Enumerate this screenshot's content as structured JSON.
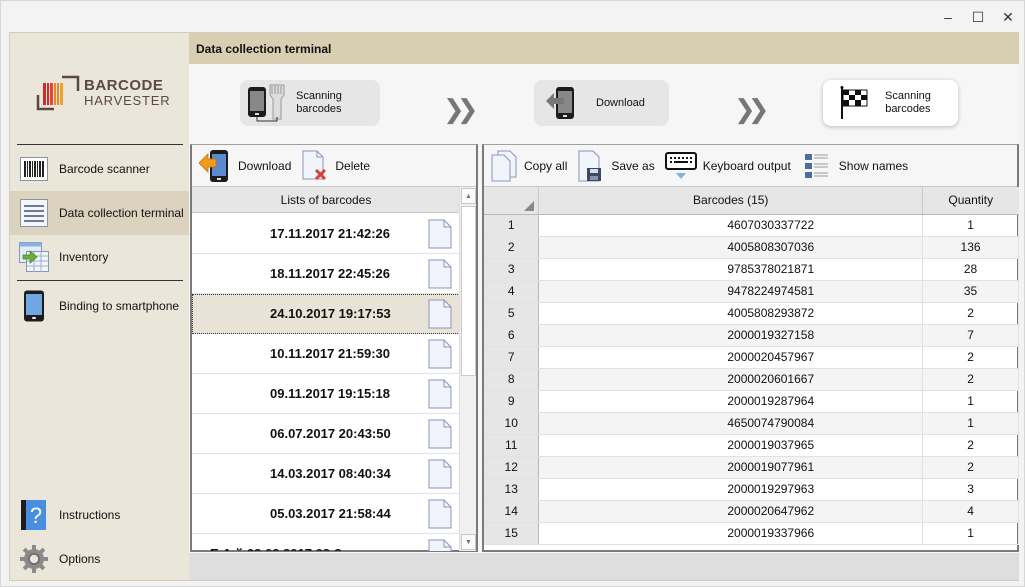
{
  "window": {
    "controls": {
      "minimize": "–",
      "maximize": "☐",
      "close": "✕"
    }
  },
  "logo": {
    "line1": "BARCODE",
    "line2": "HARVESTER"
  },
  "sidebar": {
    "items": [
      {
        "label": "Barcode scanner",
        "icon": "barcode-icon"
      },
      {
        "label": "Data collection terminal",
        "icon": "list-icon",
        "active": true
      },
      {
        "label": "Inventory",
        "icon": "inventory-table-icon"
      },
      {
        "label": "Binding to smartphone",
        "icon": "smartphone-icon"
      }
    ],
    "bottom_items": [
      {
        "label": "Instructions",
        "icon": "help-book-icon"
      },
      {
        "label": "Options",
        "icon": "gear-icon"
      }
    ]
  },
  "header": {
    "title": "Data collection terminal"
  },
  "steps": [
    {
      "label_line1": "Scanning",
      "label_line2": "barcodes",
      "icon": "terminal-scanner-icon"
    },
    {
      "label_line1": "Download",
      "label_line2": "",
      "icon": "download-phone-icon"
    },
    {
      "label_line1": "Scanning",
      "label_line2": "barcodes",
      "icon": "checkered-flag-icon",
      "current": true
    }
  ],
  "left_panel": {
    "toolbar": {
      "download": "Download",
      "delete": "Delete"
    },
    "header": "Lists of barcodes",
    "lists": [
      "17.11.2017 21:42:26",
      "18.11.2017 22:45:26",
      "24.10.2017 19:17:53",
      "10.11.2017 21:59:30",
      "09.11.2017 19:15:18",
      "06.07.2017 20:43:50",
      "14.03.2017 08:40:34",
      "05.03.2017 21:58:44",
      "Е        А       й 03.03.2017 08:3"
    ],
    "selected_index": 2
  },
  "right_panel": {
    "toolbar": {
      "copy_all": "Copy all",
      "save_as": "Save as",
      "keyboard_output": "Keyboard output",
      "show_names": "Show names"
    },
    "columns": {
      "barcodes": "Barcodes (15)",
      "quantity": "Quantity"
    },
    "rows": [
      {
        "n": "1",
        "barcode": "4607030337722",
        "qty": "1"
      },
      {
        "n": "2",
        "barcode": "4005808307036",
        "qty": "136"
      },
      {
        "n": "3",
        "barcode": "9785378021871",
        "qty": "28"
      },
      {
        "n": "4",
        "barcode": "9478224974581",
        "qty": "35"
      },
      {
        "n": "5",
        "barcode": "4005808293872",
        "qty": "2"
      },
      {
        "n": "6",
        "barcode": "2000019327158",
        "qty": "7"
      },
      {
        "n": "7",
        "barcode": "2000020457967",
        "qty": "2"
      },
      {
        "n": "8",
        "barcode": "2000020601667",
        "qty": "2"
      },
      {
        "n": "9",
        "barcode": "2000019287964",
        "qty": "1"
      },
      {
        "n": "10",
        "barcode": "4650074790084",
        "qty": "1"
      },
      {
        "n": "11",
        "barcode": "2000019037965",
        "qty": "2"
      },
      {
        "n": "12",
        "barcode": "2000019077961",
        "qty": "2"
      },
      {
        "n": "13",
        "barcode": "2000019297963",
        "qty": "3"
      },
      {
        "n": "14",
        "barcode": "2000020647962",
        "qty": "4"
      },
      {
        "n": "15",
        "barcode": "2000019337966",
        "qty": "1"
      }
    ]
  },
  "colors": {
    "sidebar_bg": "#ebe6da",
    "title_bar_bg": "#d8cfb3",
    "active_nav_bg": "#dbd3bd",
    "logo_brown": "#5a4a42",
    "logo_orange": "#e8852a",
    "logo_red": "#d9262c"
  }
}
